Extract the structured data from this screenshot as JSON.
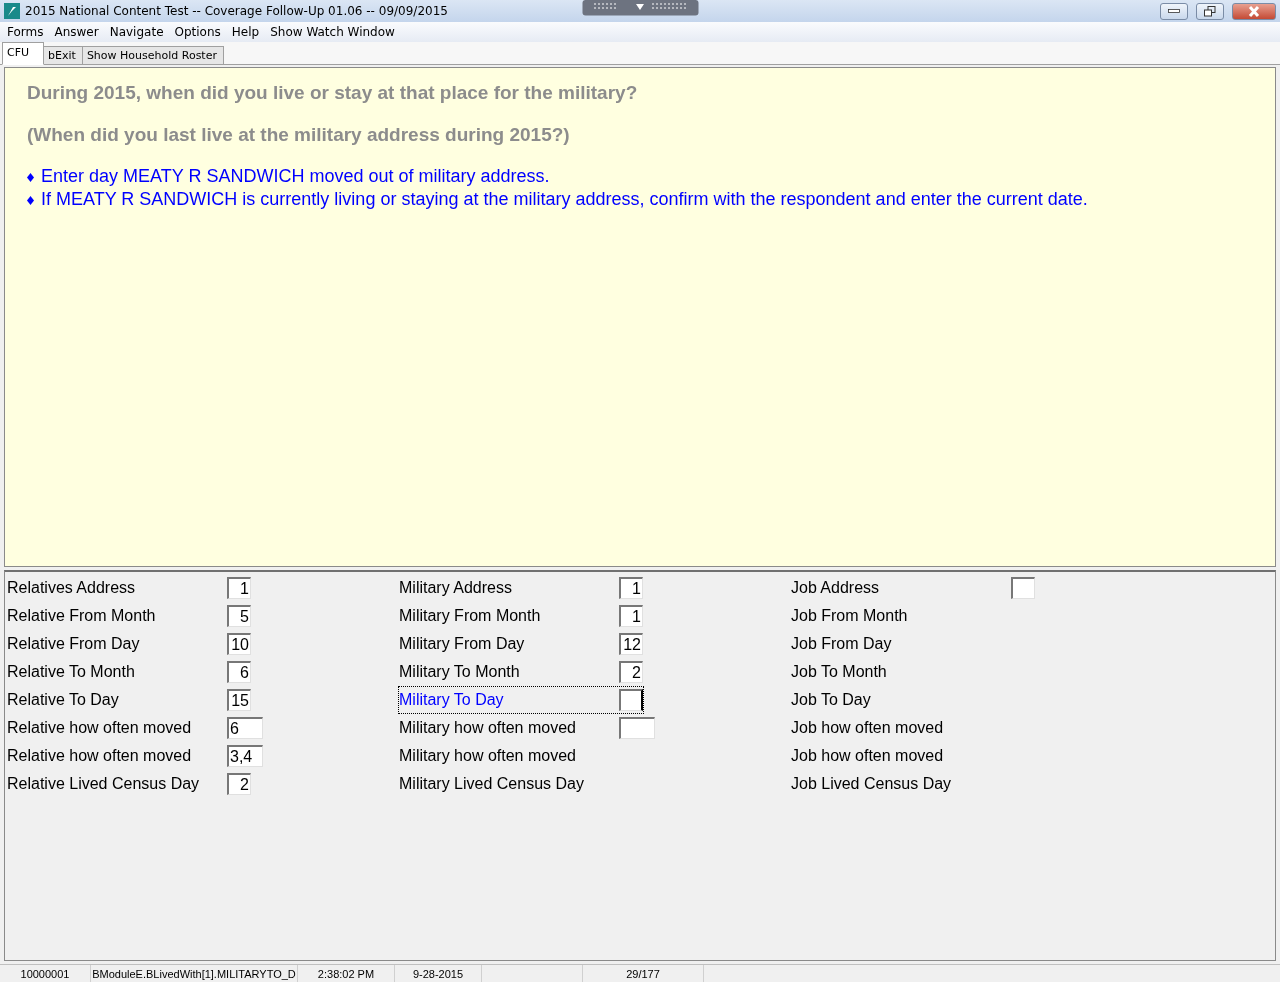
{
  "window": {
    "title": "2015 National Content Test -- Coverage Follow-Up 01.06 -- 09/09/2015"
  },
  "menu": [
    "Forms",
    "Answer",
    "Navigate",
    "Options",
    "Help",
    "Show Watch Window"
  ],
  "tabs": [
    {
      "label": "CFU",
      "selected": true
    },
    {
      "label": "bExit",
      "selected": false
    },
    {
      "label": "Show Household Roster",
      "selected": false
    }
  ],
  "question": {
    "lines": [
      "During 2015, when did you live or stay at that place for the military?",
      "(When did you last live at the military address during 2015?)"
    ],
    "instructions": [
      "Enter day MEATY R SANDWICH moved out of military address.",
      "If MEATY R SANDWICH is currently living or staying at the military address, confirm with the respondent and enter the current date."
    ]
  },
  "columns": [
    {
      "rows": [
        {
          "label": "Relatives Address",
          "kind": "short",
          "value": "1",
          "selected": false
        },
        {
          "label": "Relative From Month",
          "kind": "short",
          "value": "5",
          "selected": false
        },
        {
          "label": "Relative From Day",
          "kind": "short",
          "value": "10",
          "selected": false
        },
        {
          "label": "Relative To Month",
          "kind": "short",
          "value": "6",
          "selected": false
        },
        {
          "label": "Relative To Day",
          "kind": "short",
          "value": "15",
          "selected": false
        },
        {
          "label": "Relative how often moved",
          "kind": "long",
          "value": "6",
          "selected": false
        },
        {
          "label": "Relative how often moved",
          "kind": "long",
          "value": "3,4",
          "selected": false
        },
        {
          "label": "Relative Lived Census Day",
          "kind": "short",
          "value": "2",
          "selected": false
        }
      ]
    },
    {
      "rows": [
        {
          "label": "Military Address",
          "kind": "short",
          "value": "1",
          "selected": false
        },
        {
          "label": "Military From Month",
          "kind": "short",
          "value": "1",
          "selected": false
        },
        {
          "label": "Military From Day",
          "kind": "short",
          "value": "12",
          "selected": false
        },
        {
          "label": "Military To Month",
          "kind": "short",
          "value": "2",
          "selected": false
        },
        {
          "label": "Military To Day",
          "kind": "short",
          "selected": true
        },
        {
          "label": "Military how often moved",
          "kind": "long",
          "selected": false
        },
        {
          "label": "Military how often moved",
          "kind": "none",
          "selected": false
        },
        {
          "label": "Military Lived Census Day",
          "kind": "none",
          "selected": false
        }
      ]
    },
    {
      "rows": [
        {
          "label": "Job Address",
          "kind": "short",
          "selected": false
        },
        {
          "label": "Job From Month",
          "kind": "none",
          "selected": false
        },
        {
          "label": "Job From Day",
          "kind": "none",
          "selected": false
        },
        {
          "label": "Job To Month",
          "kind": "none",
          "selected": false
        },
        {
          "label": "Job To Day",
          "kind": "none",
          "selected": false
        },
        {
          "label": "Job how often moved",
          "kind": "none",
          "selected": false
        },
        {
          "label": "Job how often moved",
          "kind": "none",
          "selected": false
        },
        {
          "label": "Job Lived Census Day",
          "kind": "none",
          "selected": false
        }
      ]
    }
  ],
  "status_bar": [
    "10000001",
    "BModuleE.BLivedWith[1].MILITARYTO_D",
    "2:38:02 PM",
    "9-28-2015",
    "29/177"
  ]
}
